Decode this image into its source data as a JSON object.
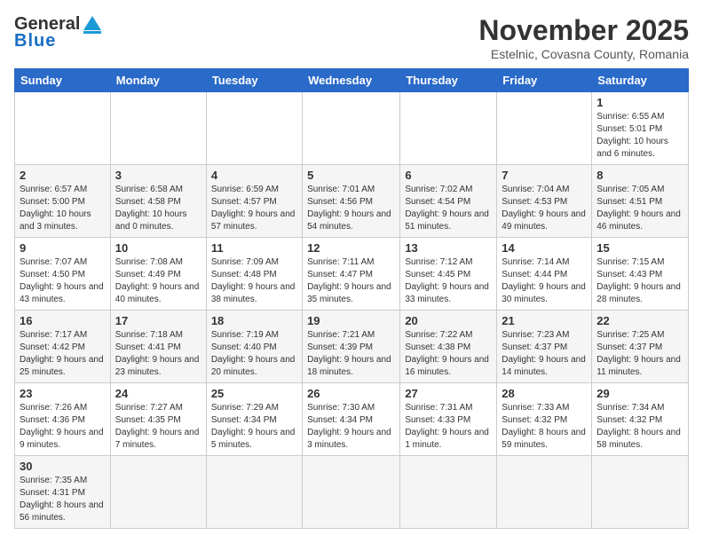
{
  "header": {
    "logo_general": "General",
    "logo_blue": "Blue",
    "month_title": "November 2025",
    "subtitle": "Estelnic, Covasna County, Romania"
  },
  "days_of_week": [
    "Sunday",
    "Monday",
    "Tuesday",
    "Wednesday",
    "Thursday",
    "Friday",
    "Saturday"
  ],
  "weeks": [
    [
      {
        "day": "",
        "info": ""
      },
      {
        "day": "",
        "info": ""
      },
      {
        "day": "",
        "info": ""
      },
      {
        "day": "",
        "info": ""
      },
      {
        "day": "",
        "info": ""
      },
      {
        "day": "",
        "info": ""
      },
      {
        "day": "1",
        "info": "Sunrise: 6:55 AM\nSunset: 5:01 PM\nDaylight: 10 hours and 6 minutes."
      }
    ],
    [
      {
        "day": "2",
        "info": "Sunrise: 6:57 AM\nSunset: 5:00 PM\nDaylight: 10 hours and 3 minutes."
      },
      {
        "day": "3",
        "info": "Sunrise: 6:58 AM\nSunset: 4:58 PM\nDaylight: 10 hours and 0 minutes."
      },
      {
        "day": "4",
        "info": "Sunrise: 6:59 AM\nSunset: 4:57 PM\nDaylight: 9 hours and 57 minutes."
      },
      {
        "day": "5",
        "info": "Sunrise: 7:01 AM\nSunset: 4:56 PM\nDaylight: 9 hours and 54 minutes."
      },
      {
        "day": "6",
        "info": "Sunrise: 7:02 AM\nSunset: 4:54 PM\nDaylight: 9 hours and 51 minutes."
      },
      {
        "day": "7",
        "info": "Sunrise: 7:04 AM\nSunset: 4:53 PM\nDaylight: 9 hours and 49 minutes."
      },
      {
        "day": "8",
        "info": "Sunrise: 7:05 AM\nSunset: 4:51 PM\nDaylight: 9 hours and 46 minutes."
      }
    ],
    [
      {
        "day": "9",
        "info": "Sunrise: 7:07 AM\nSunset: 4:50 PM\nDaylight: 9 hours and 43 minutes."
      },
      {
        "day": "10",
        "info": "Sunrise: 7:08 AM\nSunset: 4:49 PM\nDaylight: 9 hours and 40 minutes."
      },
      {
        "day": "11",
        "info": "Sunrise: 7:09 AM\nSunset: 4:48 PM\nDaylight: 9 hours and 38 minutes."
      },
      {
        "day": "12",
        "info": "Sunrise: 7:11 AM\nSunset: 4:47 PM\nDaylight: 9 hours and 35 minutes."
      },
      {
        "day": "13",
        "info": "Sunrise: 7:12 AM\nSunset: 4:45 PM\nDaylight: 9 hours and 33 minutes."
      },
      {
        "day": "14",
        "info": "Sunrise: 7:14 AM\nSunset: 4:44 PM\nDaylight: 9 hours and 30 minutes."
      },
      {
        "day": "15",
        "info": "Sunrise: 7:15 AM\nSunset: 4:43 PM\nDaylight: 9 hours and 28 minutes."
      }
    ],
    [
      {
        "day": "16",
        "info": "Sunrise: 7:17 AM\nSunset: 4:42 PM\nDaylight: 9 hours and 25 minutes."
      },
      {
        "day": "17",
        "info": "Sunrise: 7:18 AM\nSunset: 4:41 PM\nDaylight: 9 hours and 23 minutes."
      },
      {
        "day": "18",
        "info": "Sunrise: 7:19 AM\nSunset: 4:40 PM\nDaylight: 9 hours and 20 minutes."
      },
      {
        "day": "19",
        "info": "Sunrise: 7:21 AM\nSunset: 4:39 PM\nDaylight: 9 hours and 18 minutes."
      },
      {
        "day": "20",
        "info": "Sunrise: 7:22 AM\nSunset: 4:38 PM\nDaylight: 9 hours and 16 minutes."
      },
      {
        "day": "21",
        "info": "Sunrise: 7:23 AM\nSunset: 4:37 PM\nDaylight: 9 hours and 14 minutes."
      },
      {
        "day": "22",
        "info": "Sunrise: 7:25 AM\nSunset: 4:37 PM\nDaylight: 9 hours and 11 minutes."
      }
    ],
    [
      {
        "day": "23",
        "info": "Sunrise: 7:26 AM\nSunset: 4:36 PM\nDaylight: 9 hours and 9 minutes."
      },
      {
        "day": "24",
        "info": "Sunrise: 7:27 AM\nSunset: 4:35 PM\nDaylight: 9 hours and 7 minutes."
      },
      {
        "day": "25",
        "info": "Sunrise: 7:29 AM\nSunset: 4:34 PM\nDaylight: 9 hours and 5 minutes."
      },
      {
        "day": "26",
        "info": "Sunrise: 7:30 AM\nSunset: 4:34 PM\nDaylight: 9 hours and 3 minutes."
      },
      {
        "day": "27",
        "info": "Sunrise: 7:31 AM\nSunset: 4:33 PM\nDaylight: 9 hours and 1 minute."
      },
      {
        "day": "28",
        "info": "Sunrise: 7:33 AM\nSunset: 4:32 PM\nDaylight: 8 hours and 59 minutes."
      },
      {
        "day": "29",
        "info": "Sunrise: 7:34 AM\nSunset: 4:32 PM\nDaylight: 8 hours and 58 minutes."
      }
    ],
    [
      {
        "day": "30",
        "info": "Sunrise: 7:35 AM\nSunset: 4:31 PM\nDaylight: 8 hours and 56 minutes."
      },
      {
        "day": "",
        "info": ""
      },
      {
        "day": "",
        "info": ""
      },
      {
        "day": "",
        "info": ""
      },
      {
        "day": "",
        "info": ""
      },
      {
        "day": "",
        "info": ""
      },
      {
        "day": "",
        "info": ""
      }
    ]
  ]
}
